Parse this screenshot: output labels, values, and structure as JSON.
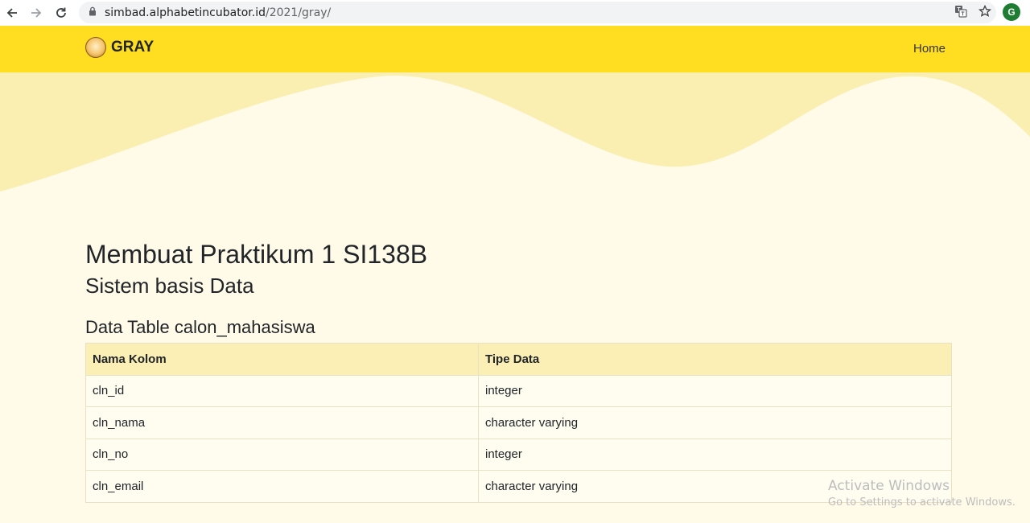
{
  "browser": {
    "url_domain": "simbad.alphabetincubator.id",
    "url_path": "/2021/gray/",
    "profile_initial": "G"
  },
  "navbar": {
    "brand": "GRAY",
    "home_link": "Home",
    "background": "#ffde22"
  },
  "main": {
    "title": "Membuat Praktikum 1 SI138B",
    "subtitle": "Sistem basis Data",
    "table_title": "Data Table calon_mahasiswa",
    "table": {
      "headers": [
        "Nama Kolom",
        "Tipe Data"
      ],
      "rows": [
        [
          "cln_id",
          "integer"
        ],
        [
          "cln_nama",
          "character varying"
        ],
        [
          "cln_no",
          "integer"
        ],
        [
          "cln_email",
          "character varying"
        ]
      ]
    }
  },
  "watermark": {
    "title": "Activate Windows",
    "subtitle": "Go to Settings to activate Windows."
  }
}
